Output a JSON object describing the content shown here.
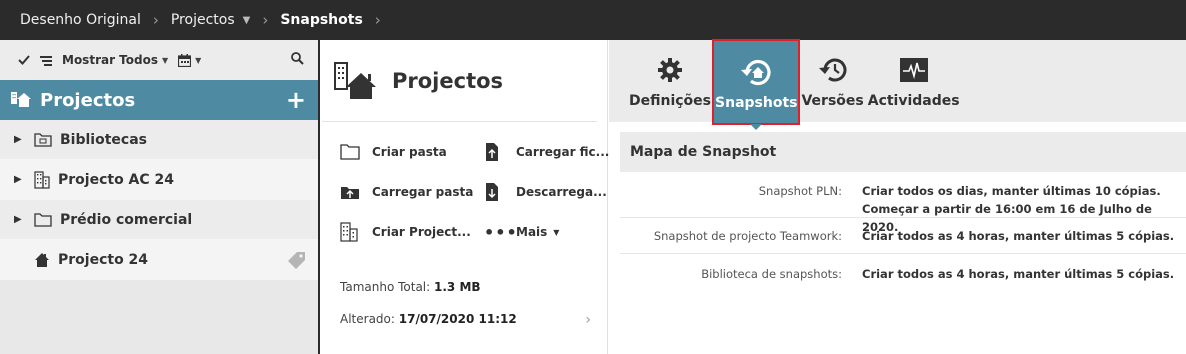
{
  "breadcrumb": {
    "items": [
      "Desenho Original",
      "Projectos",
      "Snapshots"
    ]
  },
  "left": {
    "toolbar": {
      "show_all_label": "Mostrar Todos"
    },
    "header_title": "Projectos",
    "tree": [
      {
        "label": "Bibliotecas",
        "icon": "library-folder-icon",
        "expandable": true
      },
      {
        "label": "Projecto AC 24",
        "icon": "building-icon",
        "expandable": true
      },
      {
        "label": "Prédio comercial",
        "icon": "folder-icon",
        "expandable": true
      },
      {
        "label": "Projecto 24",
        "icon": "house-icon",
        "expandable": false
      }
    ]
  },
  "middle": {
    "title": "Projectos",
    "actions": {
      "create_folder": "Criar pasta",
      "upload_file": "Carregar fic...",
      "upload_folder": "Carregar pasta",
      "download": "Descarrega...",
      "create_project": "Criar Project...",
      "more": "Mais"
    },
    "total_size_label": "Tamanho Total:",
    "total_size_value": "1.3 MB",
    "modified_label": "Alterado:",
    "modified_value": "17/07/2020 11:12"
  },
  "right": {
    "tabs": [
      "Definições",
      "Snapshots",
      "Versões",
      "Actividades"
    ],
    "active_tab": "Snapshots",
    "section_title": "Mapa de Snapshot",
    "rows": [
      {
        "label": "Snapshot PLN:",
        "line1": "Criar todos os dias, manter últimas 10 cópias.",
        "line2": "Começar a partir de 16:00 em 16 de Julho de 2020."
      },
      {
        "label": "Snapshot de projecto Teamwork:",
        "line1": "Criar todos as 4 horas, manter últimas 5 cópias."
      },
      {
        "label": "Biblioteca de snapshots:",
        "line1": "Criar todos as 4 horas, manter últimas 5 cópias."
      }
    ]
  },
  "colors": {
    "accent": "#4e8ba3",
    "topbar": "#2b2b2b",
    "highlight": "#e0202a"
  }
}
